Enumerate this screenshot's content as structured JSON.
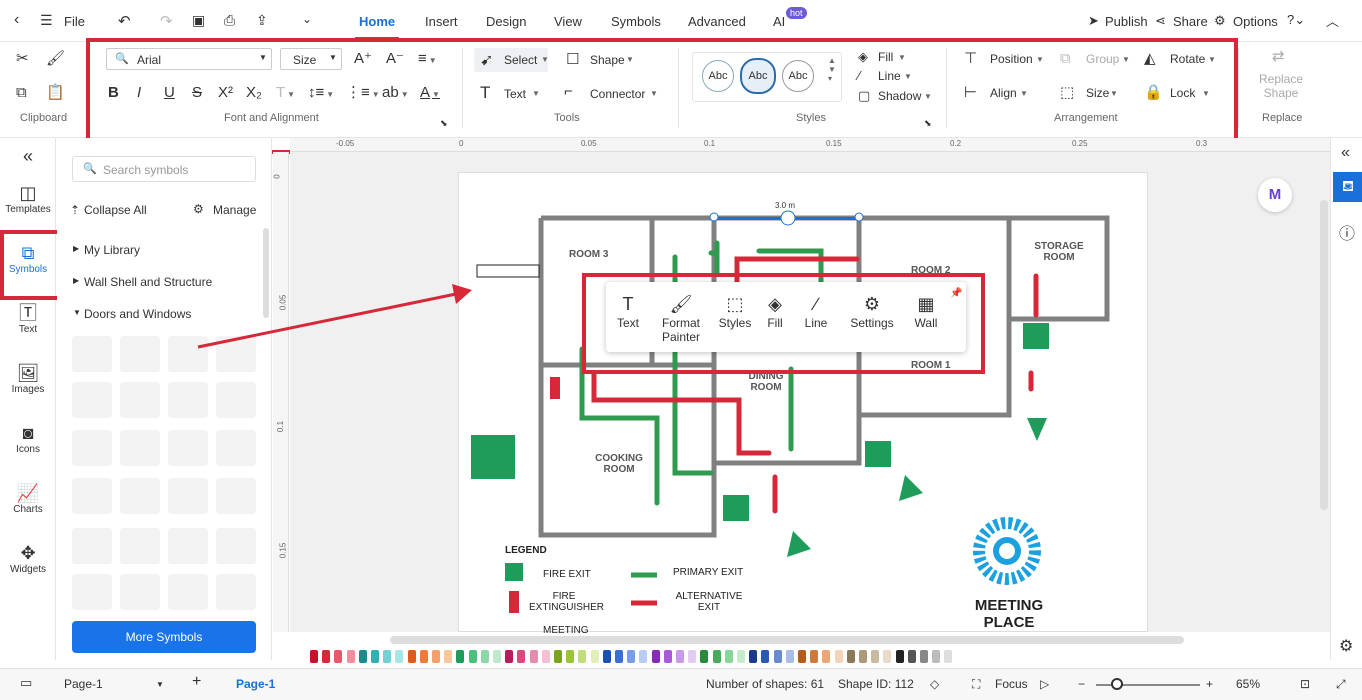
{
  "menubar": {
    "file": "File",
    "tabs": [
      "Home",
      "Insert",
      "Design",
      "View",
      "Symbols",
      "Advanced",
      "AI"
    ],
    "hot": "hot",
    "publish": "Publish",
    "share": "Share",
    "options": "Options"
  },
  "ribbon": {
    "clipboard_label": "Clipboard",
    "font": "Arial",
    "size": "Size",
    "font_group_label": "Font and Alignment",
    "select": "Select",
    "shape": "Shape",
    "text": "Text",
    "connector": "Connector",
    "tools_label": "Tools",
    "style_samples": [
      "Abc",
      "Abc",
      "Abc"
    ],
    "fill": "Fill",
    "line": "Line",
    "shadow": "Shadow",
    "styles_label": "Styles",
    "position": "Position",
    "group": "Group",
    "rotate": "Rotate",
    "align": "Align",
    "lock": "Lock",
    "arrangement_label": "Arrangement",
    "replace_shape": "Replace Shape",
    "replace_label": "Replace"
  },
  "ruler": {
    "h": [
      "-0.05",
      "0",
      "0.05",
      "0.1",
      "0.15",
      "0.2",
      "0.25",
      "0.3"
    ],
    "v": [
      "0",
      "0.05",
      "0.1",
      "0.15"
    ]
  },
  "sidebar": {
    "items": [
      "Templates",
      "Symbols",
      "Text",
      "Images",
      "Icons",
      "Charts",
      "Widgets"
    ]
  },
  "library": {
    "search_placeholder": "Search symbols",
    "collapse": "Collapse All",
    "manage": "Manage",
    "sections": [
      "My Library",
      "Wall Shell and Structure",
      "Doors and Windows"
    ],
    "more": "More Symbols"
  },
  "popup": {
    "tools": [
      "Text",
      "Format Painter",
      "Styles",
      "Fill",
      "Line",
      "Settings",
      "Wall"
    ]
  },
  "plan": {
    "dimension": "3.0 m",
    "rooms": {
      "room3": "ROOM 3",
      "storage": "STORAGE ROOM",
      "room2": "ROOM 2",
      "room1": "ROOM 1",
      "dining": "DINING ROOM",
      "cooking": "COOKING ROOM"
    },
    "legend_title": "LEGEND",
    "legend": {
      "fire_exit": "FIRE EXIT",
      "extinguisher": "FIRE EXTINGUISHER",
      "primary": "PRIMARY EXIT",
      "alternative": "ALTERNATIVE EXIT",
      "meeting": "MEETING"
    },
    "meeting_place": "MEETING PLACE"
  },
  "status": {
    "page_select": "Page-1",
    "page_tab": "Page-1",
    "shapes": "Number of shapes: 61",
    "shape_id": "Shape ID: 112",
    "focus": "Focus",
    "zoom": "65%"
  },
  "colors": {
    "accent": "#1a6fd8",
    "red": "#d62839",
    "green": "#1f9c5a"
  }
}
